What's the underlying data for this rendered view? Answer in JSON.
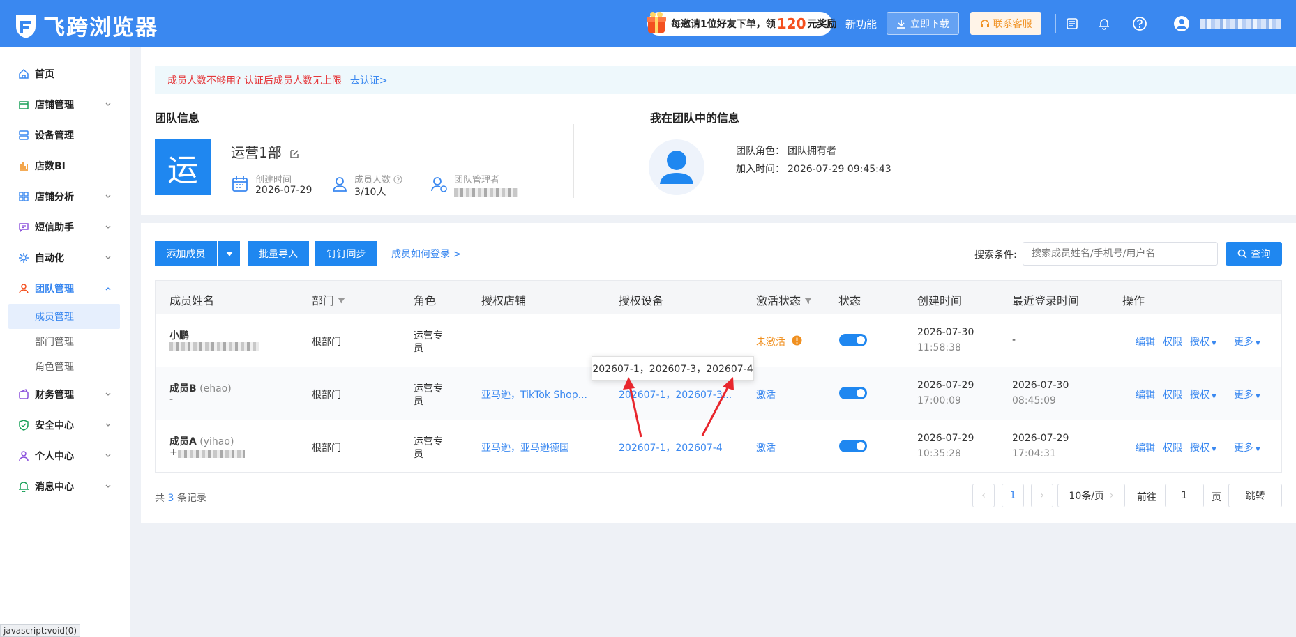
{
  "app": {
    "title": "飞跨浏览器"
  },
  "header": {
    "promo_text": "每邀请1位好友下单，领",
    "promo_amount": "120",
    "promo_suffix": "元奖励",
    "new_feature": "新功能",
    "download": "立即下载",
    "support": "联系客服"
  },
  "sidebar": {
    "items": [
      {
        "label": "首页",
        "icon": "home-icon"
      },
      {
        "label": "店铺管理",
        "icon": "store-icon"
      },
      {
        "label": "设备管理",
        "icon": "device-icon"
      },
      {
        "label": "店数BI",
        "icon": "chart-icon"
      },
      {
        "label": "店铺分析",
        "icon": "grid-icon"
      },
      {
        "label": "短信助手",
        "icon": "message-icon"
      },
      {
        "label": "自动化",
        "icon": "automation-icon"
      },
      {
        "label": "团队管理",
        "icon": "team-icon"
      },
      {
        "label": "财务管理",
        "icon": "wallet-icon"
      },
      {
        "label": "安全中心",
        "icon": "shield-icon"
      },
      {
        "label": "个人中心",
        "icon": "user-icon"
      },
      {
        "label": "消息中心",
        "icon": "bell-icon"
      }
    ],
    "sub_items": [
      "成员管理",
      "部门管理",
      "角色管理"
    ]
  },
  "notice": {
    "text": "成员人数不够用? 认证后成员人数无上限",
    "link": "去认证>"
  },
  "team_info": {
    "title": "团队信息",
    "avatar_char": "运",
    "name": "运营1部",
    "created_label": "创建时间",
    "created_value": "2026-07-29",
    "members_label": "成员人数",
    "members_value": "3/10人",
    "manager_label": "团队管理者"
  },
  "my_info": {
    "title": "我在团队中的信息",
    "role_label": "团队角色：",
    "role_value": "团队拥有者",
    "join_label": "加入时间：",
    "join_value": "2026-07-29 09:45:43"
  },
  "toolbar": {
    "add_member": "添加成员",
    "batch_import": "批量导入",
    "dingtalk_sync": "钉钉同步",
    "login_help": "成员如何登录 >",
    "search_label": "搜索条件:",
    "search_placeholder": "搜索成员姓名/手机号/用户名",
    "query": "查询"
  },
  "table": {
    "headers": [
      "成员姓名",
      "部门",
      "角色",
      "授权店铺",
      "授权设备",
      "激活状态",
      "状态",
      "创建时间",
      "最近登录时间",
      "操作"
    ],
    "rows": [
      {
        "name": "小鹏",
        "username": "",
        "sub": "",
        "dept": "根部门",
        "role_l1": "运营专",
        "role_l2": "员",
        "stores": "",
        "devices": "",
        "activation": "未激活",
        "created_date": "2026-07-30",
        "created_time": "11:58:38",
        "login_date": "-",
        "login_time": ""
      },
      {
        "name": "成员B",
        "username": "(ehao)",
        "sub": "-",
        "dept": "根部门",
        "role_l1": "运营专",
        "role_l2": "员",
        "stores": "亚马逊，TikTok Shop...",
        "devices": "202607-1，202607-3...",
        "activation": "激活",
        "created_date": "2026-07-29",
        "created_time": "17:00:09",
        "login_date": "2026-07-30",
        "login_time": "08:45:09"
      },
      {
        "name": "成员A",
        "username": "(yihao)",
        "sub": "+",
        "dept": "根部门",
        "role_l1": "运营专",
        "role_l2": "员",
        "stores": "亚马逊，亚马逊德国",
        "devices": "202607-1，202607-4",
        "activation": "激活",
        "created_date": "2026-07-29",
        "created_time": "10:35:28",
        "login_date": "2026-07-29",
        "login_time": "17:04:31"
      }
    ],
    "ops": [
      "编辑",
      "权限",
      "授权",
      "更多"
    ]
  },
  "tooltip": "202607-1，202607-3，202607-4",
  "pagination": {
    "total_prefix": "共",
    "total": "3",
    "total_suffix": "条记录",
    "page": "1",
    "page_size": "10条/页",
    "goto_label": "前往",
    "goto_value": "1",
    "page_unit": "页",
    "jump": "跳转"
  },
  "statusbar": "javascript:void(0)",
  "colors": {
    "primary": "#3a88f0",
    "button": "#1f87f0",
    "danger": "#e5383b",
    "warning": "#f09020"
  }
}
